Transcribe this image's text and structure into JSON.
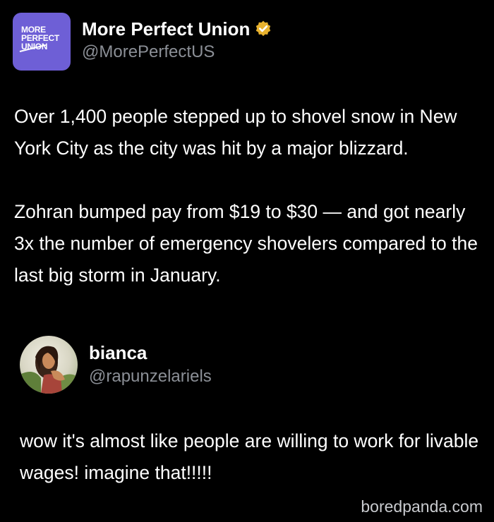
{
  "tweet": {
    "avatar_logo_text": "MORE\nPERFECT\nUNION",
    "display_name": "More Perfect Union",
    "handle": "@MorePerfectUS",
    "verified_icon": "verified-badge-icon",
    "paragraphs": [
      "Over 1,400 people stepped up to shovel snow in New York City as the city was hit by a major blizzard.",
      "Zohran bumped pay from $19 to $30 — and got nearly 3x the number of emergency shovelers compared to the last big storm in January."
    ]
  },
  "reply": {
    "display_name": "bianca",
    "handle": "@rapunzelariels",
    "text": "wow it's almost like people are willing to work for livable wages! imagine that!!!!!"
  },
  "watermark": "boredpanda.com",
  "colors": {
    "background": "#000000",
    "brand_avatar": "#6e5fd6",
    "verified_badge": "#e8b22e",
    "handle_gray": "#8b8f96"
  }
}
